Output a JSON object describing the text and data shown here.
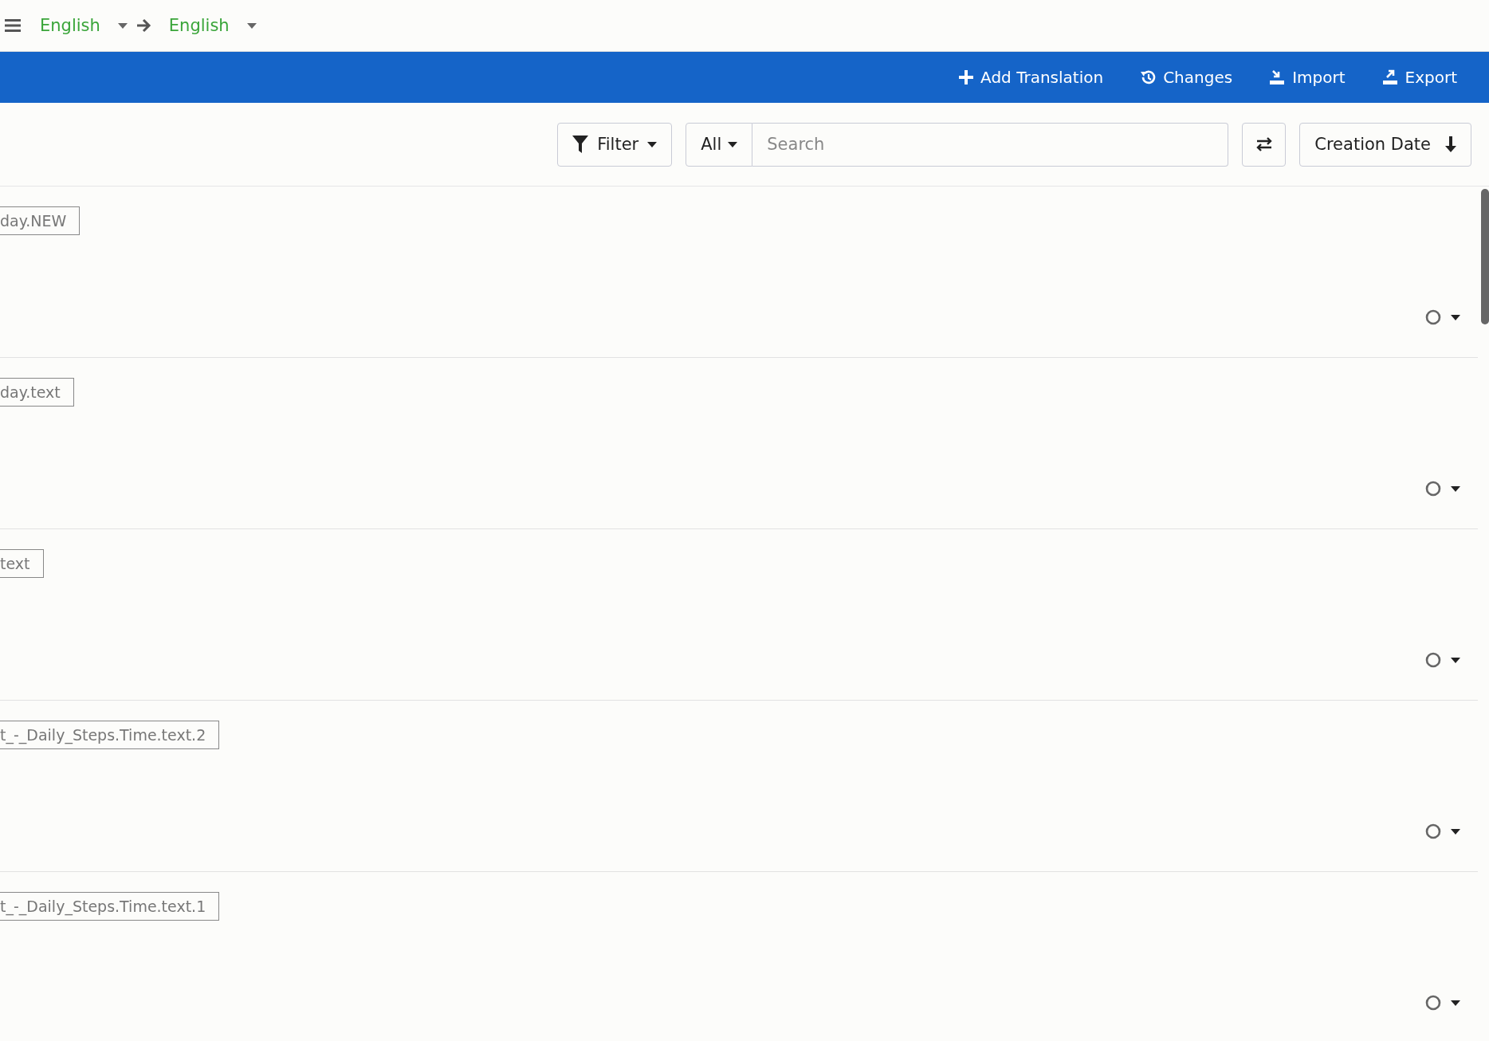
{
  "header": {
    "source_language": "English",
    "target_language": "English"
  },
  "actions": [
    {
      "kind": "add",
      "label": "Add Translation"
    },
    {
      "kind": "history",
      "label": "Changes"
    },
    {
      "kind": "import",
      "label": "Import"
    },
    {
      "kind": "export",
      "label": "Export"
    }
  ],
  "toolbar": {
    "filter": "Filter",
    "scope": "All",
    "search": {
      "placeholder": "Search"
    },
    "sort": "Creation Date"
  },
  "rows": [
    {
      "key": "day.NEW"
    },
    {
      "key": "day.text"
    },
    {
      "key": "text"
    },
    {
      "key": "t_-_Daily_Steps.Time.text.2"
    },
    {
      "key": "t_-_Daily_Steps.Time.text.1"
    }
  ]
}
